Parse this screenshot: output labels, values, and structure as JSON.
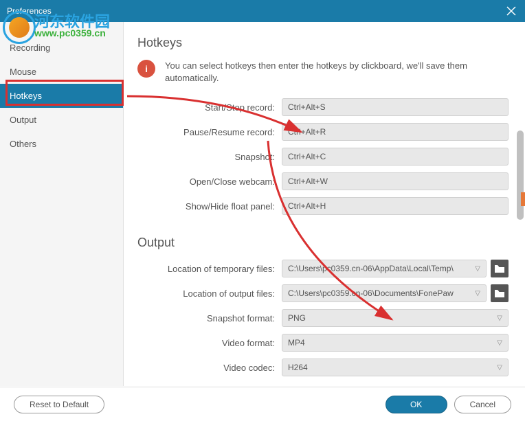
{
  "titlebar": {
    "title": "Preferences"
  },
  "sidebar": {
    "items": [
      {
        "label": "Recording"
      },
      {
        "label": "Mouse"
      },
      {
        "label": "Hotkeys"
      },
      {
        "label": "Output"
      },
      {
        "label": "Others"
      }
    ]
  },
  "hotkeys": {
    "title": "Hotkeys",
    "info": "You can select hotkeys then enter the hotkeys by clickboard, we'll save them automatically.",
    "fields": [
      {
        "label": "Start/Stop record:",
        "value": "Ctrl+Alt+S"
      },
      {
        "label": "Pause/Resume record:",
        "value": "Ctrl+Alt+R"
      },
      {
        "label": "Snapshot:",
        "value": "Ctrl+Alt+C"
      },
      {
        "label": "Open/Close webcam:",
        "value": "Ctrl+Alt+W"
      },
      {
        "label": "Show/Hide float panel:",
        "value": "Ctrl+Alt+H"
      }
    ]
  },
  "output": {
    "title": "Output",
    "fields": [
      {
        "label": "Location of temporary files:",
        "value": "C:\\Users\\pc0359.cn-06\\AppData\\Local\\Temp\\",
        "type": "path"
      },
      {
        "label": "Location of output files:",
        "value": "C:\\Users\\pc0359.cn-06\\Documents\\FonePaw",
        "type": "path"
      },
      {
        "label": "Snapshot format:",
        "value": "PNG",
        "type": "select"
      },
      {
        "label": "Video format:",
        "value": "MP4",
        "type": "select"
      },
      {
        "label": "Video codec:",
        "value": "H264",
        "type": "select"
      }
    ]
  },
  "footer": {
    "reset": "Reset to Default",
    "ok": "OK",
    "cancel": "Cancel"
  },
  "watermark": {
    "cn": "河东软件园",
    "url": "www.pc0359.cn"
  }
}
